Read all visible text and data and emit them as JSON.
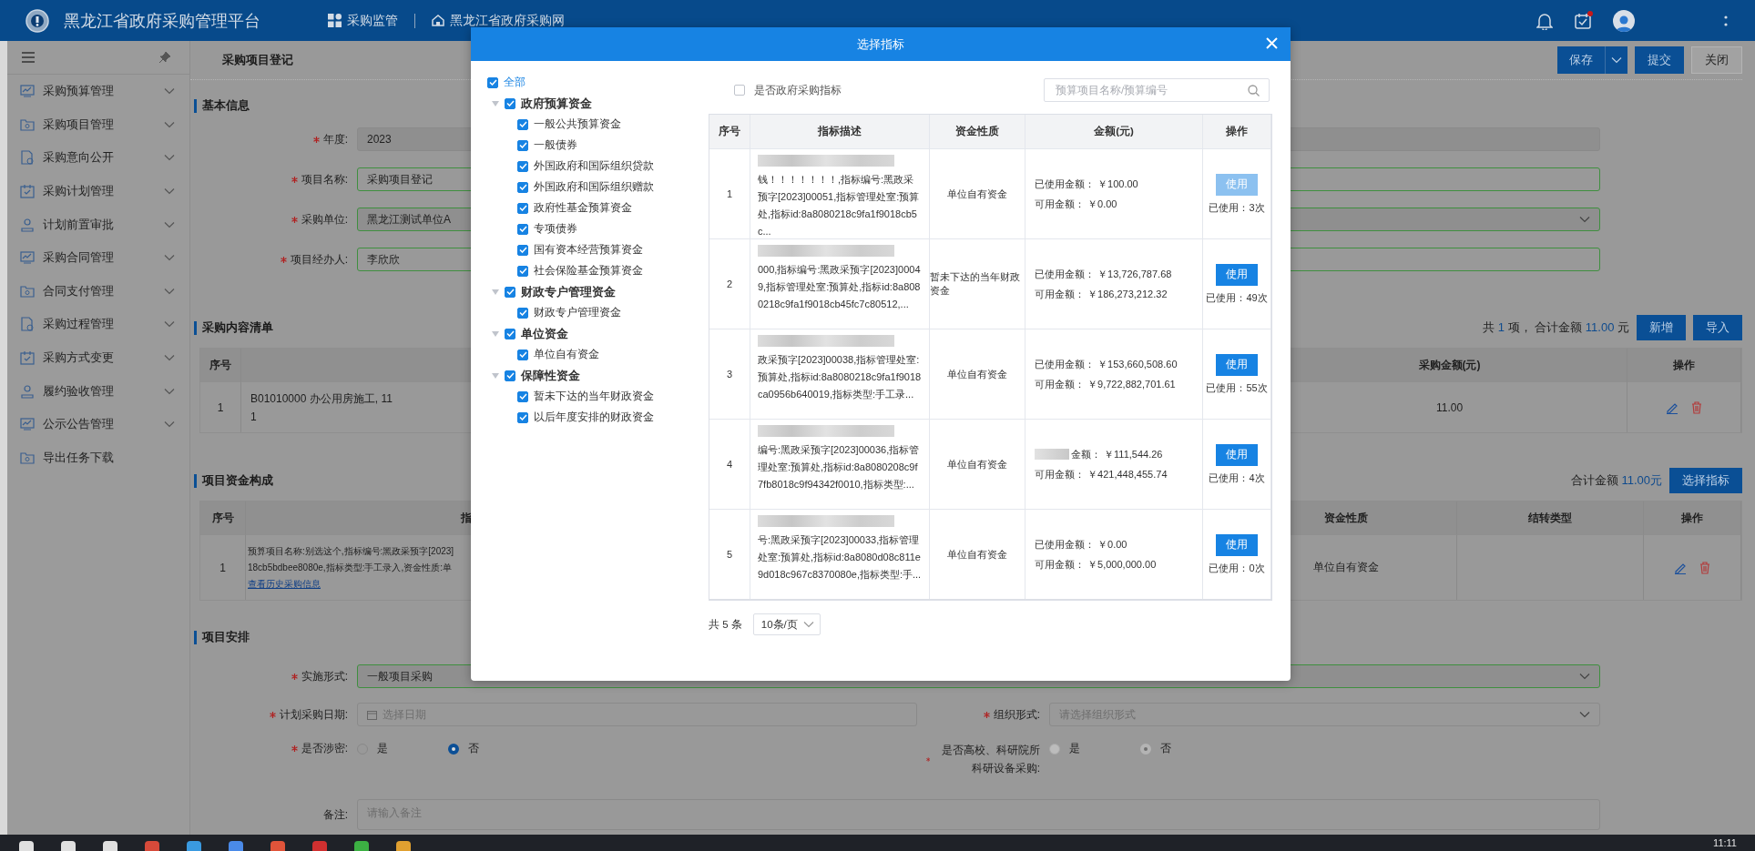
{
  "header": {
    "title": "黑龙江省政府采购管理平台",
    "nav": [
      {
        "label": "采购监管"
      },
      {
        "label": "黑龙江省政府采购网"
      }
    ],
    "task_alert": true
  },
  "sidebar": {
    "items": [
      {
        "label": "采购预算管理",
        "kind": "group"
      },
      {
        "label": "采购项目管理",
        "kind": "group"
      },
      {
        "label": "采购意向公开",
        "kind": "group"
      },
      {
        "label": "采购计划管理",
        "kind": "group"
      },
      {
        "label": "计划前置审批",
        "kind": "group"
      },
      {
        "label": "采购合同管理",
        "kind": "group"
      },
      {
        "label": "合同支付管理",
        "kind": "group"
      },
      {
        "label": "采购过程管理",
        "kind": "group"
      },
      {
        "label": "采购方式变更",
        "kind": "group"
      },
      {
        "label": "履约验收管理",
        "kind": "group"
      },
      {
        "label": "公示公告管理",
        "kind": "group"
      },
      {
        "label": "导出任务下载",
        "kind": "link"
      }
    ]
  },
  "page": {
    "title": "采购项目登记",
    "actions": [
      {
        "label": "保存",
        "kind": "split"
      },
      {
        "label": "提交",
        "kind": "primary"
      },
      {
        "label": "关闭",
        "kind": "plain"
      }
    ]
  },
  "basic_info": {
    "heading": "基本信息",
    "fields": [
      {
        "label": "年度:",
        "required": true,
        "value": "2023",
        "kind": "text",
        "disabled": true,
        "valid": false
      },
      {
        "label": "项目名称:",
        "required": true,
        "value": "采购项目登记",
        "kind": "text",
        "disabled": false,
        "valid": true
      },
      {
        "label": "采购单位:",
        "required": true,
        "value": "黑龙江测试单位A",
        "kind": "select",
        "disabled": true,
        "valid": true
      },
      {
        "label": "项目经办人:",
        "required": true,
        "value": "李欣欣",
        "kind": "text",
        "disabled": false,
        "valid": true
      }
    ]
  },
  "content_list": {
    "heading": "采购内容清单",
    "summary": {
      "prefix": "共",
      "count": "1",
      "middle": "项， 合计金额",
      "total": "11.00",
      "suffix": "元"
    },
    "buttons": [
      "新增",
      "导入"
    ],
    "columns": {
      "index": "序号",
      "amount": "采购金额(元)",
      "action": "操作"
    },
    "rows": [
      {
        "index": "1",
        "content": [
          "B01010000 办公用房施工, 11",
          "1"
        ],
        "amount": "11.00"
      }
    ]
  },
  "funding": {
    "heading": "项目资金构成",
    "total_label": "合计金额",
    "total": "11.00元",
    "button": "选择指标",
    "columns": {
      "index": "序号",
      "indicator": "指",
      "fund_nature": "资金性质",
      "carryover": "结转类型",
      "action": "操作"
    },
    "rows": [
      {
        "index": "1",
        "indicator": [
          "预算项目名称:别选这个,指标编号:黑政采预字[2023]",
          "18cb5bdbee8080e,指标类型:手工录入,资金性质:单"
        ],
        "link": "查看历史采购信息",
        "fund_nature": "单位自有资金"
      }
    ]
  },
  "arrangement": {
    "heading": "项目安排",
    "form_method": {
      "label": "实施形式:",
      "required": true,
      "value": "一般项目采购",
      "valid": true
    },
    "date": {
      "label": "计划采购日期:",
      "required": true,
      "placeholder": "选择日期"
    },
    "organization": {
      "label": "组织形式:",
      "required": true,
      "placeholder": "请选择组织形式"
    },
    "radios": [
      {
        "label": "是否涉密:",
        "required": true,
        "disabled": false,
        "options": [
          {
            "label": "是",
            "selected": false
          },
          {
            "label": "否",
            "selected": true
          }
        ]
      },
      {
        "label": "是否高校、科研院所科研设备采购:",
        "required": true,
        "disabled": true,
        "options": [
          {
            "label": "是",
            "selected": false
          },
          {
            "label": "否",
            "selected": true
          }
        ]
      }
    ],
    "remark": {
      "label": "备注:",
      "placeholder": "请输入备注"
    }
  },
  "modal": {
    "title": "选择指标",
    "tree": [
      {
        "label": "全部",
        "checked": true,
        "children": [
          {
            "label": "政府预算资金",
            "checked": true,
            "expanded": true,
            "children": [
              {
                "label": "一般公共预算资金",
                "checked": true
              },
              {
                "label": "一般债券",
                "checked": true
              },
              {
                "label": "外国政府和国际组织贷款",
                "checked": true
              },
              {
                "label": "外国政府和国际组织赠款",
                "checked": true
              },
              {
                "label": "政府性基金预算资金",
                "checked": true
              },
              {
                "label": "专项债券",
                "checked": true
              },
              {
                "label": "国有资本经营预算资金",
                "checked": true
              },
              {
                "label": "社会保险基金预算资金",
                "checked": true
              }
            ]
          },
          {
            "label": "财政专户管理资金",
            "checked": true,
            "expanded": true,
            "children": [
              {
                "label": "财政专户管理资金",
                "checked": true
              }
            ]
          },
          {
            "label": "单位资金",
            "checked": true,
            "expanded": true,
            "children": [
              {
                "label": "单位自有资金",
                "checked": true
              }
            ]
          },
          {
            "label": "保障性资金",
            "checked": true,
            "expanded": true,
            "children": [
              {
                "label": "暂未下达的当年财政资金",
                "checked": true
              },
              {
                "label": "以后年度安排的财政资金",
                "checked": true
              }
            ]
          }
        ]
      }
    ],
    "filter": {
      "label": "是否政府采购指标",
      "checked": false
    },
    "search": {
      "placeholder": "预算项目名称/预算编号"
    },
    "columns": [
      "序号",
      "指标描述",
      "资金性质",
      "金额(元)",
      "操作"
    ],
    "rows": [
      {
        "index": "1",
        "description": "钱！！！！！！！,指标编号:黑政采预字[2023]00051,指标管理处室:预算处,指标id:8a8080218c9fa1f9018cb5c...",
        "fund_nature": "单位自有资金",
        "used_label": "已使用金额：",
        "used": "￥100.00",
        "available_label": "可用金额：",
        "available": "￥0.00",
        "button": "使用",
        "disabled": true,
        "usage": "已使用：3次",
        "label_redacted": false
      },
      {
        "index": "2",
        "description": "000,指标编号:黑政采预字[2023]00049,指标管理处室:预算处,指标id:8a8080218c9fa1f9018cb45fc7c80512,...",
        "fund_nature": "暂未下达的当年财政资金",
        "used_label": "已使用金额：",
        "used": "￥13,726,787.68",
        "available_label": "可用金额：",
        "available": "￥186,273,212.32",
        "button": "使用",
        "disabled": false,
        "usage": "已使用：49次",
        "label_redacted": false
      },
      {
        "index": "3",
        "description": "政采预字[2023]00038,指标管理处室:预算处,指标id:8a8080218c9fa1f9018ca0956b640019,指标类型:手工录...",
        "fund_nature": "单位自有资金",
        "used_label": "已使用金额：",
        "used": "￥153,660,508.60",
        "available_label": "可用金额：",
        "available": "￥9,722,882,701.61",
        "button": "使用",
        "disabled": false,
        "usage": "已使用：55次",
        "label_redacted": false
      },
      {
        "index": "4",
        "description": "编号:黑政采预字[2023]00036,指标管理处室:预算处,指标id:8a8080208c9f7fb8018c9f94342f0010,指标类型:...",
        "fund_nature": "单位自有资金",
        "used_label": "金额：",
        "used": "￥111,544.26",
        "available_label": "可用金额：",
        "available": "￥421,448,455.74",
        "button": "使用",
        "disabled": false,
        "usage": "已使用：4次",
        "label_redacted": true
      },
      {
        "index": "5",
        "description": "号:黑政采预字[2023]00033,指标管理处室:预算处,指标id:8a8080d08c811e9d018c967c8370080e,指标类型:手...",
        "fund_nature": "单位自有资金",
        "used_label": "已使用金额：",
        "used": "￥0.00",
        "available_label": "可用金额：",
        "available": "￥5,000,000.00",
        "button": "使用",
        "disabled": false,
        "usage": "已使用：0次",
        "label_redacted": false
      }
    ],
    "pagination": {
      "total": "共 5 条",
      "page_size": "10条/页"
    }
  },
  "taskbar": {
    "time": "11:11"
  }
}
